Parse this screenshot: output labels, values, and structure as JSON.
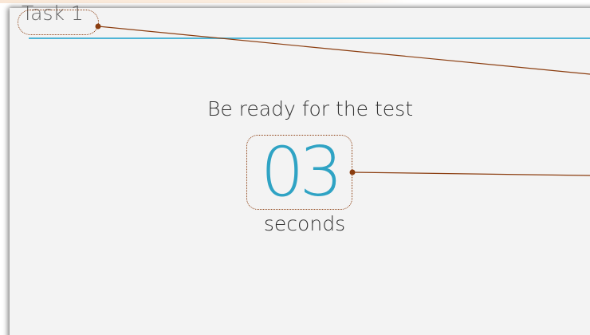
{
  "header": {
    "task_title": "Task 1"
  },
  "main": {
    "prompt": "Be ready for the test",
    "countdown_value": "03",
    "countdown_unit": "seconds"
  },
  "colors": {
    "accent": "#2fa3c4",
    "header_rule": "#4fb5d6",
    "annotation": "#8b3d0f",
    "background": "#f3f3f3"
  }
}
